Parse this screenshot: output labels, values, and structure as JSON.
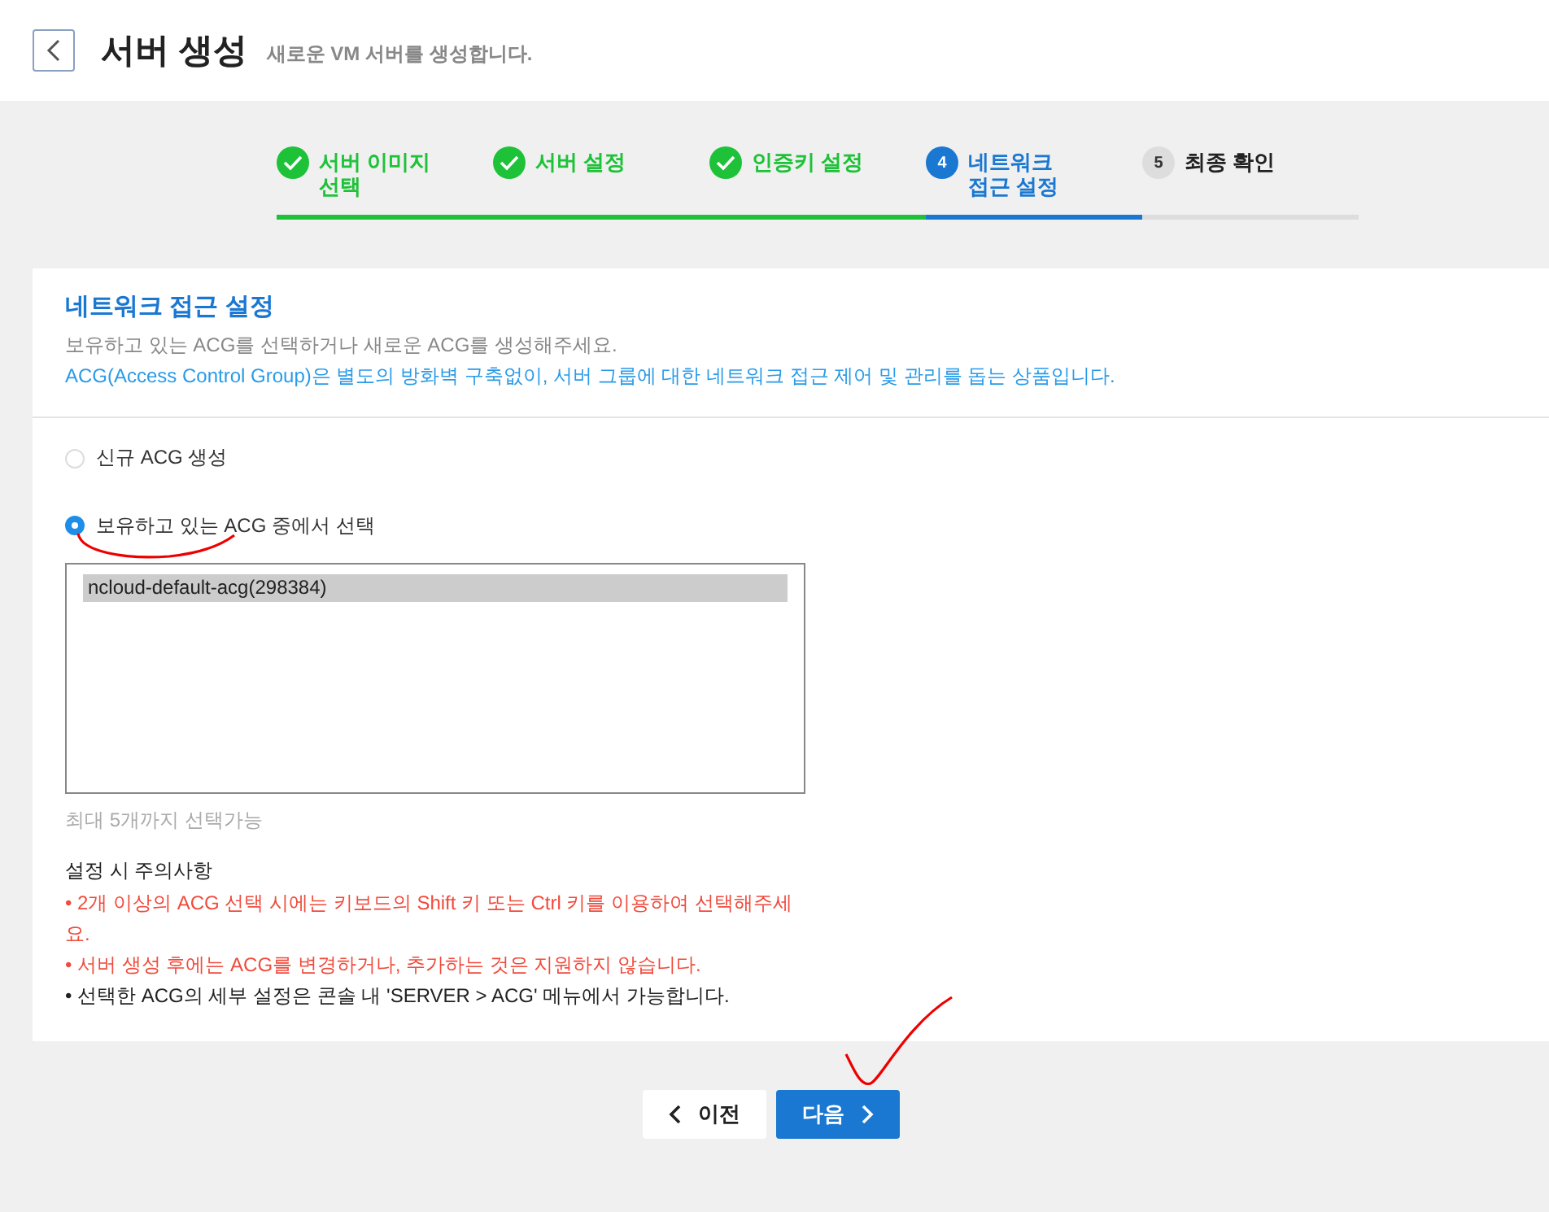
{
  "header": {
    "title": "서버 생성",
    "subtitle": "새로운 VM 서버를 생성합니다."
  },
  "steps": [
    {
      "label": "서버 이미지 선택",
      "completed": true,
      "selected": false
    },
    {
      "label": "서버 설정",
      "completed": true,
      "selected": false
    },
    {
      "label": "인증키 설정",
      "completed": true,
      "selected": false
    },
    {
      "number": "4",
      "label": "네트워크 접근 설정",
      "completed": false,
      "selected": true
    },
    {
      "number": "5",
      "label": "최종 확인",
      "completed": false,
      "selected": false
    }
  ],
  "section": {
    "title": "네트워크 접근 설정",
    "description": "보유하고 있는 ACG를 선택하거나 새로운 ACG를 생성해주세요.",
    "info": "ACG(Access Control Group)은 별도의 방화벽 구축없이, 서버 그룹에 대한 네트워크 접근 제어 및 관리를 돕는 상품입니다."
  },
  "options": [
    {
      "label": "신규 ACG 생성",
      "selected": false
    },
    {
      "label": "보유하고 있는 ACG 중에서 선택",
      "selected": true
    }
  ],
  "acg_list": [
    {
      "name": "ncloud-default-acg(298384)",
      "selected": true
    }
  ],
  "limit_hint": "최대 5개까지 선택가능",
  "notes": {
    "title": "설정 시 주의사항",
    "items": [
      {
        "text": "• 2개 이상의 ACG 선택 시에는 키보드의 Shift 키 또는 Ctrl 키를 이용하여 선택해주세요.",
        "kind": "warning"
      },
      {
        "text": "• 서버 생성 후에는 ACG를 변경하거나, 추가하는 것은 지원하지 않습니다.",
        "kind": "warning"
      },
      {
        "text": "• 선택한 ACG의 세부 설정은 콘솔 내 'SERVER > ACG' 메뉴에서 가능합니다.",
        "kind": "info"
      }
    ]
  },
  "buttons": [
    {
      "label": "이전",
      "kind": "prev"
    },
    {
      "label": "다음",
      "kind": "next"
    }
  ],
  "annotations": [
    {
      "kind": "underline"
    },
    {
      "kind": "checkmark"
    }
  ]
}
